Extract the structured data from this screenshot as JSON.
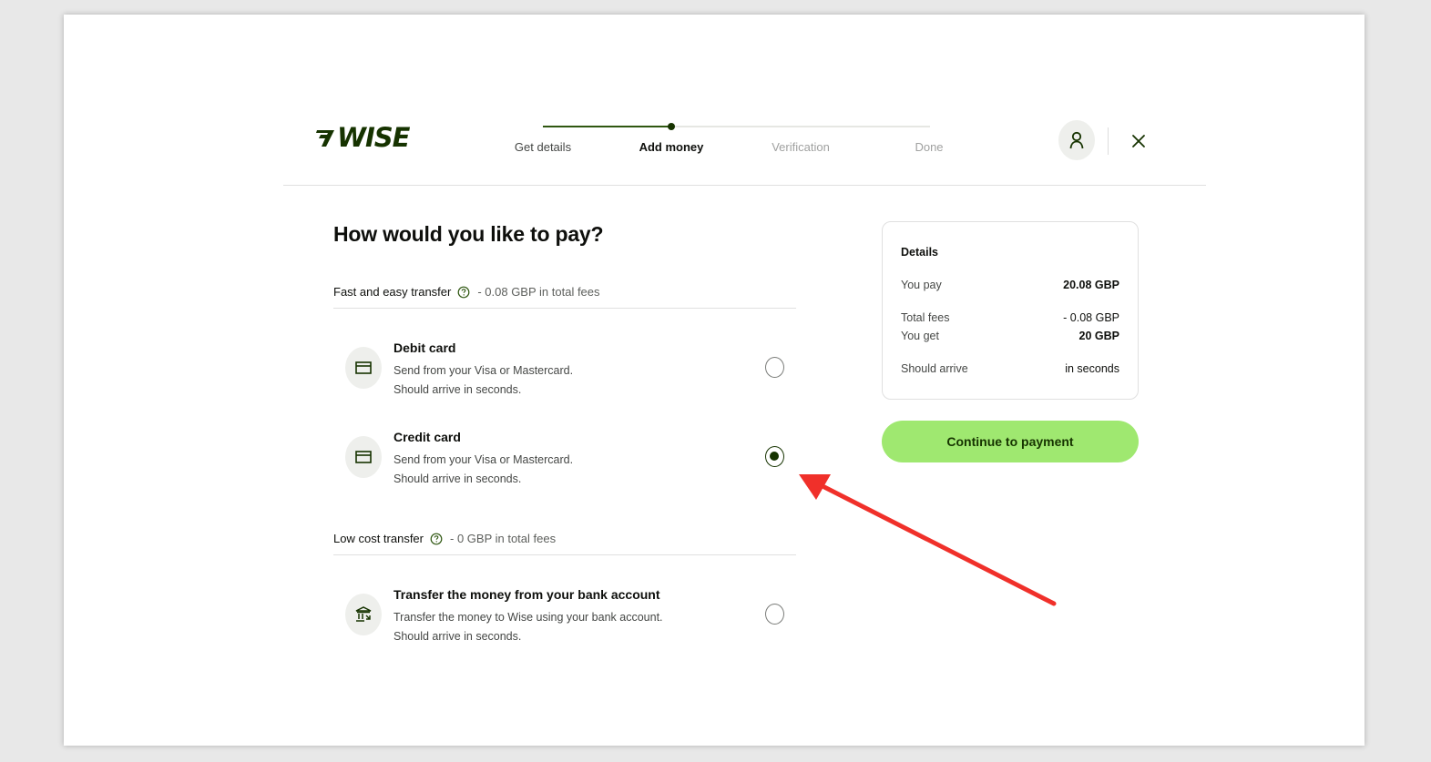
{
  "brand": {
    "name": "WISE",
    "color": "#163300",
    "accent": "#9fe870"
  },
  "stepper": {
    "steps": [
      {
        "label": "Get details",
        "state": "done"
      },
      {
        "label": "Add money",
        "state": "current"
      },
      {
        "label": "Verification",
        "state": "upcoming"
      },
      {
        "label": "Done",
        "state": "upcoming"
      }
    ]
  },
  "header": {
    "avatar_icon": "user-icon",
    "close_icon": "close-icon"
  },
  "main": {
    "title": "How would you like to pay?",
    "sections": [
      {
        "label": "Fast and easy transfer",
        "fee": "- 0.08 GBP in total fees",
        "options": [
          {
            "icon": "card-icon",
            "title": "Debit card",
            "line1": "Send from your Visa or Mastercard.",
            "line2": "Should arrive in seconds.",
            "selected": false
          },
          {
            "icon": "card-icon",
            "title": "Credit card",
            "line1": "Send from your Visa or Mastercard.",
            "line2": "Should arrive in seconds.",
            "selected": true
          }
        ]
      },
      {
        "label": "Low cost transfer",
        "fee": "- 0 GBP in total fees",
        "options": [
          {
            "icon": "bank-icon",
            "title": "Transfer the money from your bank account",
            "line1": "Transfer the money to Wise using your bank account.",
            "line2": "Should arrive in seconds.",
            "selected": false
          }
        ]
      }
    ]
  },
  "details": {
    "title": "Details",
    "you_pay_label": "You pay",
    "you_pay_value": "20.08 GBP",
    "total_fees_label": "Total fees",
    "total_fees_value": "- 0.08 GBP",
    "you_get_label": "You get",
    "you_get_value": "20 GBP",
    "arrive_label": "Should arrive",
    "arrive_value": "in seconds"
  },
  "continue_label": "Continue to payment",
  "annotation": {
    "color": "#f0302a"
  }
}
